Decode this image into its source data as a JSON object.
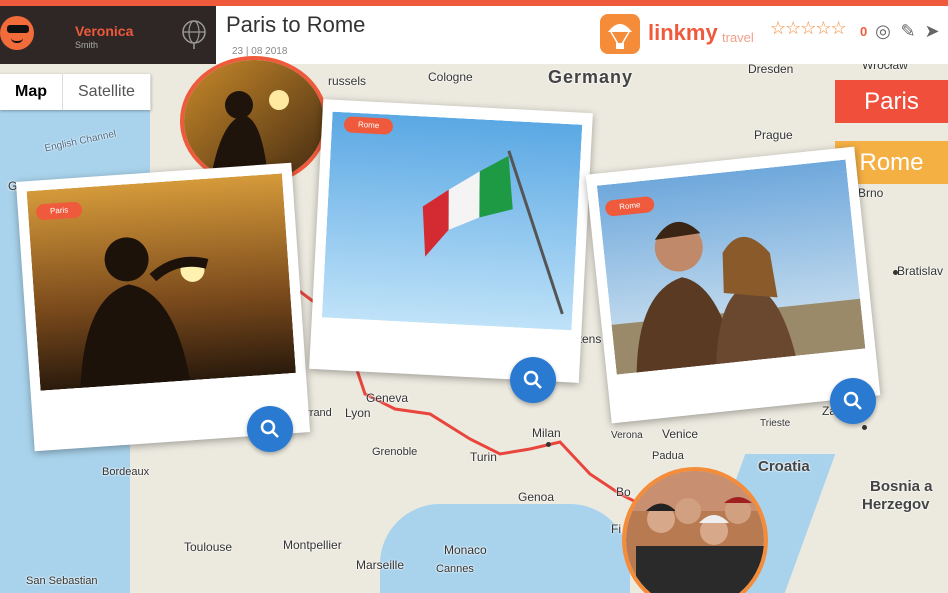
{
  "user": {
    "first_name": "Veronica",
    "last_name": "Smith"
  },
  "trip": {
    "title": "Paris to Rome",
    "date": "23 | 08 2018"
  },
  "brand": {
    "name_main": "linkmy",
    "name_sub": "travel"
  },
  "rating": {
    "stars": "☆☆☆☆☆",
    "count": "0"
  },
  "map_toggle": {
    "map": "Map",
    "satellite": "Satellite"
  },
  "legend": {
    "paris": "Paris",
    "rome": "Rome"
  },
  "photos": [
    {
      "tag": "Paris"
    },
    {
      "tag": "Rome"
    },
    {
      "tag": "Rome"
    }
  ],
  "map_labels": {
    "germany": "Germany",
    "croatia": "Croatia",
    "bosnia": "Bosnia a",
    "herzego": "Herzegov",
    "cologne": "Cologne",
    "brussels": "russels",
    "dresden": "Dresden",
    "wroclaw": "Wrocław",
    "prague": "Prague",
    "brno": "Brno",
    "bratislava": "Bratislav",
    "english_channel": "English Channel",
    "guernsey": "Guernse",
    "lyon": "Lyon",
    "geneva": "Geneva",
    "milan": "Milan",
    "turin": "Turin",
    "verona": "Verona",
    "venice": "Venice",
    "trieste": "Trieste",
    "zagreb": "Za",
    "grenoble": "Grenoble",
    "genoa": "Genoa",
    "bordeaux": "Bordeaux",
    "toulouse": "Toulouse",
    "montpellier": "Montpellier",
    "monaco": "Monaco",
    "marseille": "Marseille",
    "cannes": "Cannes",
    "padua": "Padua",
    "bologna": "Bo",
    "liechtenstein": "chtens",
    "fi": "Fi",
    "san_sebastian": "San Sebastian",
    "errand": "errand"
  },
  "colors": {
    "accent": "#ef5a3c",
    "rome": "#f5b044",
    "zoom": "#2a7ad2",
    "route": "#e8453c"
  }
}
